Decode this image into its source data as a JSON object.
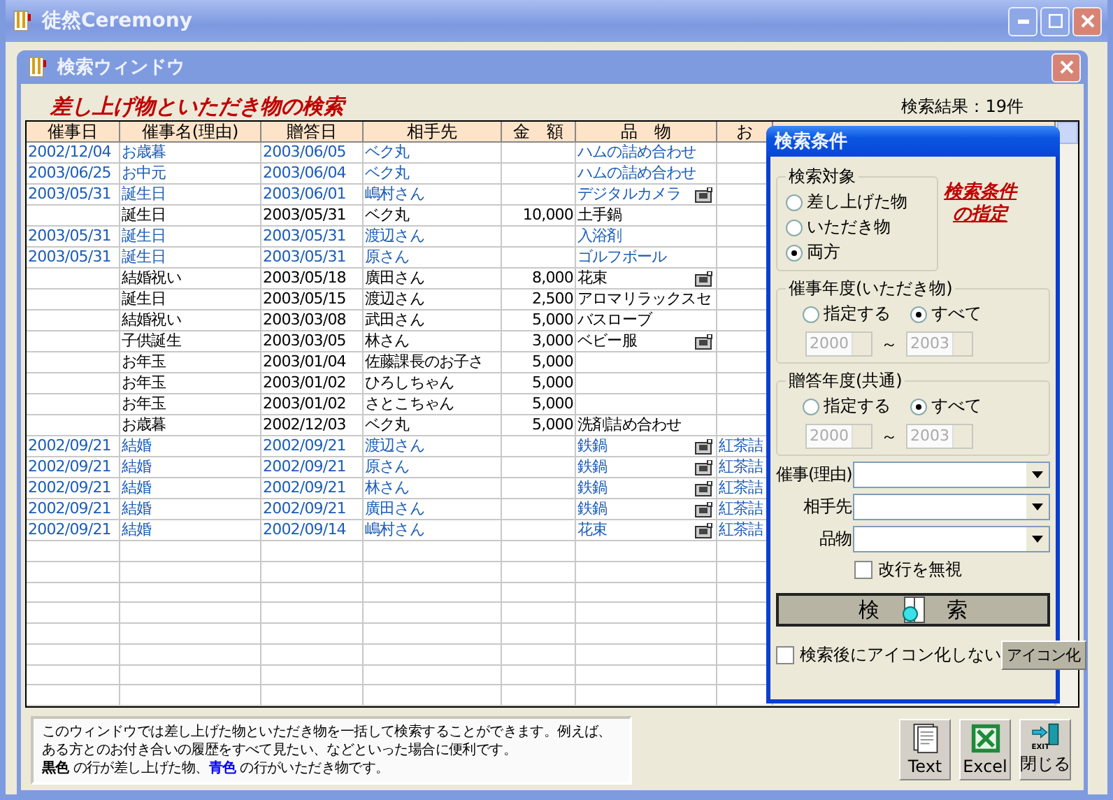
{
  "app_window": {
    "title": "徒然Ceremony"
  },
  "search_window": {
    "title": "検索ウィンドウ",
    "heading": "差し上げ物といただき物の検索",
    "result_count": "検索結果：19件"
  },
  "table": {
    "columns": [
      "催事日",
      "催事名(理由)",
      "贈答日",
      "相手先",
      "金　額",
      "品　物",
      "お"
    ],
    "rows": [
      {
        "kind": "received",
        "cells": [
          "2002/12/04",
          "お歳暮",
          "2003/06/05",
          "ベク丸",
          "",
          "ハムの詰め合わせ",
          ""
        ],
        "has_image": false
      },
      {
        "kind": "received",
        "cells": [
          "2003/06/25",
          "お中元",
          "2003/06/04",
          "ベク丸",
          "",
          "ハムの詰め合わせ",
          ""
        ],
        "has_image": false
      },
      {
        "kind": "received",
        "cells": [
          "2003/05/31",
          "誕生日",
          "2003/06/01",
          "嶋村さん",
          "",
          "デジタルカメラ",
          ""
        ],
        "has_image": true
      },
      {
        "kind": "given",
        "cells": [
          "",
          "誕生日",
          "2003/05/31",
          "ベク丸",
          "10,000",
          "土手鍋",
          ""
        ],
        "has_image": false
      },
      {
        "kind": "received",
        "cells": [
          "2003/05/31",
          "誕生日",
          "2003/05/31",
          "渡辺さん",
          "",
          "入浴剤",
          ""
        ],
        "has_image": false
      },
      {
        "kind": "received",
        "cells": [
          "2003/05/31",
          "誕生日",
          "2003/05/31",
          "原さん",
          "",
          "ゴルフボール",
          ""
        ],
        "has_image": false
      },
      {
        "kind": "given",
        "cells": [
          "",
          "結婚祝い",
          "2003/05/18",
          "廣田さん",
          "8,000",
          "花束",
          ""
        ],
        "has_image": true
      },
      {
        "kind": "given",
        "cells": [
          "",
          "誕生日",
          "2003/05/15",
          "渡辺さん",
          "2,500",
          "アロマリラックスセ",
          ""
        ],
        "has_image": false
      },
      {
        "kind": "given",
        "cells": [
          "",
          "結婚祝い",
          "2003/03/08",
          "武田さん",
          "5,000",
          "バスローブ",
          ""
        ],
        "has_image": false
      },
      {
        "kind": "given",
        "cells": [
          "",
          "子供誕生",
          "2003/03/05",
          "林さん",
          "3,000",
          "ベビー服",
          ""
        ],
        "has_image": true
      },
      {
        "kind": "given",
        "cells": [
          "",
          "お年玉",
          "2003/01/04",
          "佐藤課長のお子さ",
          "5,000",
          "",
          ""
        ],
        "has_image": false
      },
      {
        "kind": "given",
        "cells": [
          "",
          "お年玉",
          "2003/01/02",
          "ひろしちゃん",
          "5,000",
          "",
          ""
        ],
        "has_image": false
      },
      {
        "kind": "given",
        "cells": [
          "",
          "お年玉",
          "2003/01/02",
          "さとこちゃん",
          "5,000",
          "",
          ""
        ],
        "has_image": false
      },
      {
        "kind": "given",
        "cells": [
          "",
          "お歳暮",
          "2002/12/03",
          "ベク丸",
          "5,000",
          "洗剤詰め合わせ",
          ""
        ],
        "has_image": false
      },
      {
        "kind": "received",
        "cells": [
          "2002/09/21",
          "結婚",
          "2002/09/21",
          "渡辺さん",
          "",
          "鉄鍋",
          "紅茶詰"
        ],
        "has_image": true
      },
      {
        "kind": "received",
        "cells": [
          "2002/09/21",
          "結婚",
          "2002/09/21",
          "原さん",
          "",
          "鉄鍋",
          "紅茶詰"
        ],
        "has_image": true
      },
      {
        "kind": "received",
        "cells": [
          "2002/09/21",
          "結婚",
          "2002/09/21",
          "林さん",
          "",
          "鉄鍋",
          "紅茶詰"
        ],
        "has_image": true
      },
      {
        "kind": "received",
        "cells": [
          "2002/09/21",
          "結婚",
          "2002/09/21",
          "廣田さん",
          "",
          "鉄鍋",
          "紅茶詰"
        ],
        "has_image": true
      },
      {
        "kind": "received",
        "cells": [
          "2002/09/21",
          "結婚",
          "2002/09/14",
          "嶋村さん",
          "",
          "花束",
          "紅茶詰"
        ],
        "has_image": true
      }
    ]
  },
  "search_dialog": {
    "title": "検索条件",
    "target_group": {
      "label": "検索対象",
      "options": [
        {
          "label": "差し上げた物",
          "selected": false
        },
        {
          "label": "いただき物",
          "selected": false
        },
        {
          "label": "両方",
          "selected": true
        }
      ]
    },
    "caption_lines": [
      "検索条件",
      "の指定"
    ],
    "year_groups": [
      {
        "label": "催事年度(いただき物)",
        "options": [
          {
            "label": "指定する",
            "selected": false
          },
          {
            "label": "すべて",
            "selected": true
          }
        ],
        "from": "2000",
        "range_sign": "～",
        "to": "2003"
      },
      {
        "label": "贈答年度(共通)",
        "options": [
          {
            "label": "指定する",
            "selected": false
          },
          {
            "label": "すべて",
            "selected": true
          }
        ],
        "from": "2000",
        "range_sign": "～",
        "to": "2003"
      }
    ],
    "combos": [
      {
        "label": "催事(理由)"
      },
      {
        "label": "相手先"
      },
      {
        "label": "品物"
      }
    ],
    "ignore_newline": {
      "label": "改行を無視",
      "checked": false
    },
    "search_button": {
      "left": "検",
      "right": "索"
    },
    "no_iconify": {
      "label": "検索後にアイコン化しない",
      "checked": false
    },
    "iconify_button": "アイコン化"
  },
  "info": {
    "lines": [
      "このウィンドウでは差し上げた物といただき物を一括して検索することができます。例えば、",
      "ある方とのお付き合いの履歴をすべて見たい、などといった場合に便利です。"
    ],
    "legend": {
      "given_word": "黒色",
      "given_text": " の行が差し上げた物、",
      "received_word": "青色",
      "received_text": " の行がいただき物です。"
    }
  },
  "buttons": [
    {
      "kind": "text",
      "label": "Text"
    },
    {
      "kind": "excel",
      "label": "Excel"
    },
    {
      "kind": "exit",
      "label": "閉じる",
      "badge": "EXIT"
    }
  ]
}
